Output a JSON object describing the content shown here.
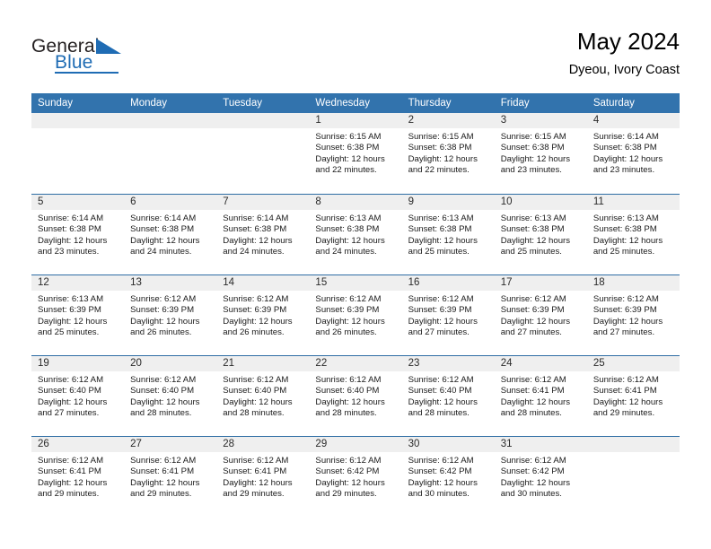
{
  "brand": {
    "name_part1": "General",
    "name_part2": "Blue",
    "accent_color": "#1f6cb4"
  },
  "header": {
    "title": "May 2024",
    "subtitle": "Dyeou, Ivory Coast"
  },
  "theme": {
    "header_row_bg": "#3273ad",
    "row_divider": "#2e6da4",
    "day_band_bg": "#efefef"
  },
  "weekdays": [
    "Sunday",
    "Monday",
    "Tuesday",
    "Wednesday",
    "Thursday",
    "Friday",
    "Saturday"
  ],
  "weeks": [
    [
      {
        "day": "",
        "empty": true
      },
      {
        "day": "",
        "empty": true
      },
      {
        "day": "",
        "empty": true
      },
      {
        "day": "1",
        "sunrise": "Sunrise: 6:15 AM",
        "sunset": "Sunset: 6:38 PM",
        "daylight": "Daylight: 12 hours and 22 minutes."
      },
      {
        "day": "2",
        "sunrise": "Sunrise: 6:15 AM",
        "sunset": "Sunset: 6:38 PM",
        "daylight": "Daylight: 12 hours and 22 minutes."
      },
      {
        "day": "3",
        "sunrise": "Sunrise: 6:15 AM",
        "sunset": "Sunset: 6:38 PM",
        "daylight": "Daylight: 12 hours and 23 minutes."
      },
      {
        "day": "4",
        "sunrise": "Sunrise: 6:14 AM",
        "sunset": "Sunset: 6:38 PM",
        "daylight": "Daylight: 12 hours and 23 minutes."
      }
    ],
    [
      {
        "day": "5",
        "sunrise": "Sunrise: 6:14 AM",
        "sunset": "Sunset: 6:38 PM",
        "daylight": "Daylight: 12 hours and 23 minutes."
      },
      {
        "day": "6",
        "sunrise": "Sunrise: 6:14 AM",
        "sunset": "Sunset: 6:38 PM",
        "daylight": "Daylight: 12 hours and 24 minutes."
      },
      {
        "day": "7",
        "sunrise": "Sunrise: 6:14 AM",
        "sunset": "Sunset: 6:38 PM",
        "daylight": "Daylight: 12 hours and 24 minutes."
      },
      {
        "day": "8",
        "sunrise": "Sunrise: 6:13 AM",
        "sunset": "Sunset: 6:38 PM",
        "daylight": "Daylight: 12 hours and 24 minutes."
      },
      {
        "day": "9",
        "sunrise": "Sunrise: 6:13 AM",
        "sunset": "Sunset: 6:38 PM",
        "daylight": "Daylight: 12 hours and 25 minutes."
      },
      {
        "day": "10",
        "sunrise": "Sunrise: 6:13 AM",
        "sunset": "Sunset: 6:38 PM",
        "daylight": "Daylight: 12 hours and 25 minutes."
      },
      {
        "day": "11",
        "sunrise": "Sunrise: 6:13 AM",
        "sunset": "Sunset: 6:38 PM",
        "daylight": "Daylight: 12 hours and 25 minutes."
      }
    ],
    [
      {
        "day": "12",
        "sunrise": "Sunrise: 6:13 AM",
        "sunset": "Sunset: 6:39 PM",
        "daylight": "Daylight: 12 hours and 25 minutes."
      },
      {
        "day": "13",
        "sunrise": "Sunrise: 6:12 AM",
        "sunset": "Sunset: 6:39 PM",
        "daylight": "Daylight: 12 hours and 26 minutes."
      },
      {
        "day": "14",
        "sunrise": "Sunrise: 6:12 AM",
        "sunset": "Sunset: 6:39 PM",
        "daylight": "Daylight: 12 hours and 26 minutes."
      },
      {
        "day": "15",
        "sunrise": "Sunrise: 6:12 AM",
        "sunset": "Sunset: 6:39 PM",
        "daylight": "Daylight: 12 hours and 26 minutes."
      },
      {
        "day": "16",
        "sunrise": "Sunrise: 6:12 AM",
        "sunset": "Sunset: 6:39 PM",
        "daylight": "Daylight: 12 hours and 27 minutes."
      },
      {
        "day": "17",
        "sunrise": "Sunrise: 6:12 AM",
        "sunset": "Sunset: 6:39 PM",
        "daylight": "Daylight: 12 hours and 27 minutes."
      },
      {
        "day": "18",
        "sunrise": "Sunrise: 6:12 AM",
        "sunset": "Sunset: 6:39 PM",
        "daylight": "Daylight: 12 hours and 27 minutes."
      }
    ],
    [
      {
        "day": "19",
        "sunrise": "Sunrise: 6:12 AM",
        "sunset": "Sunset: 6:40 PM",
        "daylight": "Daylight: 12 hours and 27 minutes."
      },
      {
        "day": "20",
        "sunrise": "Sunrise: 6:12 AM",
        "sunset": "Sunset: 6:40 PM",
        "daylight": "Daylight: 12 hours and 28 minutes."
      },
      {
        "day": "21",
        "sunrise": "Sunrise: 6:12 AM",
        "sunset": "Sunset: 6:40 PM",
        "daylight": "Daylight: 12 hours and 28 minutes."
      },
      {
        "day": "22",
        "sunrise": "Sunrise: 6:12 AM",
        "sunset": "Sunset: 6:40 PM",
        "daylight": "Daylight: 12 hours and 28 minutes."
      },
      {
        "day": "23",
        "sunrise": "Sunrise: 6:12 AM",
        "sunset": "Sunset: 6:40 PM",
        "daylight": "Daylight: 12 hours and 28 minutes."
      },
      {
        "day": "24",
        "sunrise": "Sunrise: 6:12 AM",
        "sunset": "Sunset: 6:41 PM",
        "daylight": "Daylight: 12 hours and 28 minutes."
      },
      {
        "day": "25",
        "sunrise": "Sunrise: 6:12 AM",
        "sunset": "Sunset: 6:41 PM",
        "daylight": "Daylight: 12 hours and 29 minutes."
      }
    ],
    [
      {
        "day": "26",
        "sunrise": "Sunrise: 6:12 AM",
        "sunset": "Sunset: 6:41 PM",
        "daylight": "Daylight: 12 hours and 29 minutes."
      },
      {
        "day": "27",
        "sunrise": "Sunrise: 6:12 AM",
        "sunset": "Sunset: 6:41 PM",
        "daylight": "Daylight: 12 hours and 29 minutes."
      },
      {
        "day": "28",
        "sunrise": "Sunrise: 6:12 AM",
        "sunset": "Sunset: 6:41 PM",
        "daylight": "Daylight: 12 hours and 29 minutes."
      },
      {
        "day": "29",
        "sunrise": "Sunrise: 6:12 AM",
        "sunset": "Sunset: 6:42 PM",
        "daylight": "Daylight: 12 hours and 29 minutes."
      },
      {
        "day": "30",
        "sunrise": "Sunrise: 6:12 AM",
        "sunset": "Sunset: 6:42 PM",
        "daylight": "Daylight: 12 hours and 30 minutes."
      },
      {
        "day": "31",
        "sunrise": "Sunrise: 6:12 AM",
        "sunset": "Sunset: 6:42 PM",
        "daylight": "Daylight: 12 hours and 30 minutes."
      },
      {
        "day": "",
        "empty": true
      }
    ]
  ]
}
